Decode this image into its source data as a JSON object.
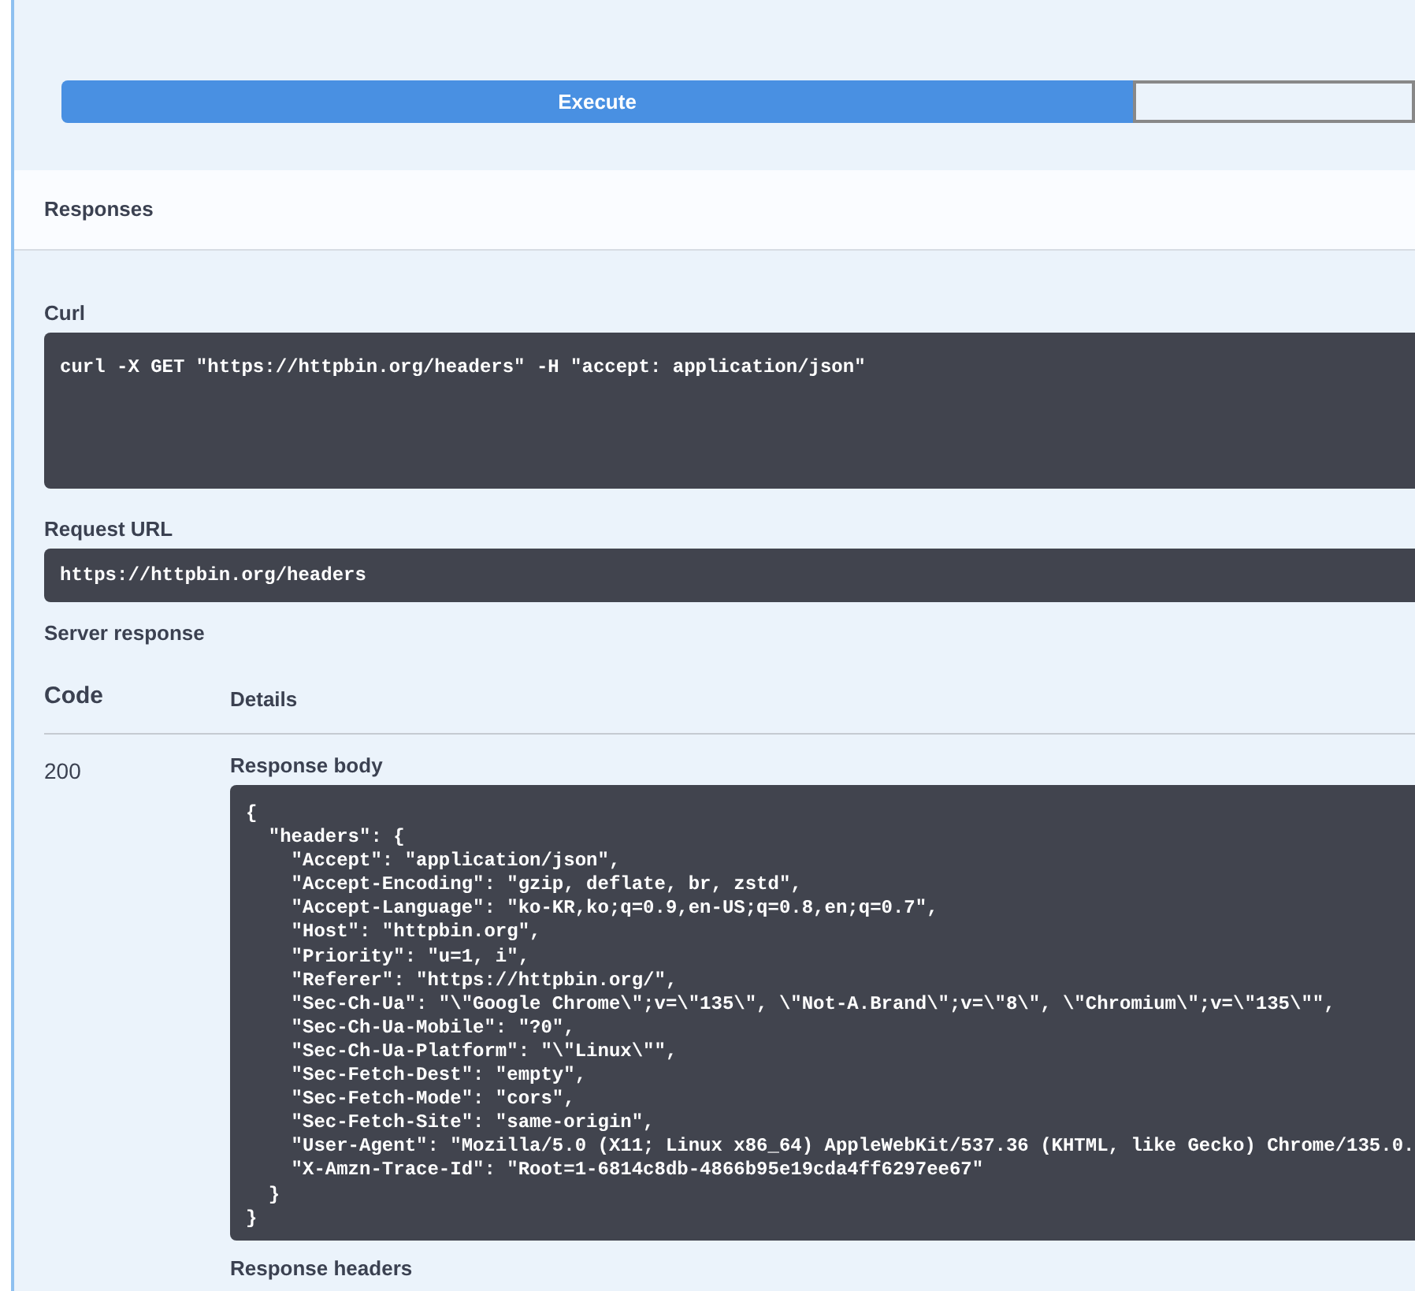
{
  "execute_button": {
    "label": "Execute"
  },
  "responses": {
    "title": "Responses"
  },
  "curl": {
    "label": "Curl",
    "command": "curl -X GET \"https://httpbin.org/headers\" -H \"accept: application/json\""
  },
  "request_url": {
    "label": "Request URL",
    "url": "https://httpbin.org/headers"
  },
  "server_response": {
    "label": "Server response",
    "columns": [
      "Code",
      "Details"
    ],
    "code": "200",
    "body_label": "Response body",
    "body_lines": [
      "{",
      "  \"headers\": {",
      "    \"Accept\": \"application/json\",",
      "    \"Accept-Encoding\": \"gzip, deflate, br, zstd\",",
      "    \"Accept-Language\": \"ko-KR,ko;q=0.9,en-US;q=0.8,en;q=0.7\",",
      "    \"Host\": \"httpbin.org\",",
      "    \"Priority\": \"u=1, i\",",
      "    \"Referer\": \"https://httpbin.org/\",",
      "    \"Sec-Ch-Ua\": \"\\\"Google Chrome\\\";v=\\\"135\\\", \\\"Not-A.Brand\\\";v=\\\"8\\\", \\\"Chromium\\\";v=\\\"135\\\"\",",
      "    \"Sec-Ch-Ua-Mobile\": \"?0\",",
      "    \"Sec-Ch-Ua-Platform\": \"\\\"Linux\\\"\",",
      "    \"Sec-Fetch-Dest\": \"empty\",",
      "    \"Sec-Fetch-Mode\": \"cors\",",
      "    \"Sec-Fetch-Site\": \"same-origin\",",
      "    \"User-Agent\": \"Mozilla/5.0 (X11; Linux x86_64) AppleWebKit/537.36 (KHTML, like Gecko) Chrome/135.0.",
      "    \"X-Amzn-Trace-Id\": \"Root=1-6814c8db-4866b95e19cda4ff6297ee67\"",
      "  }",
      "}"
    ],
    "headers_label": "Response headers"
  }
}
